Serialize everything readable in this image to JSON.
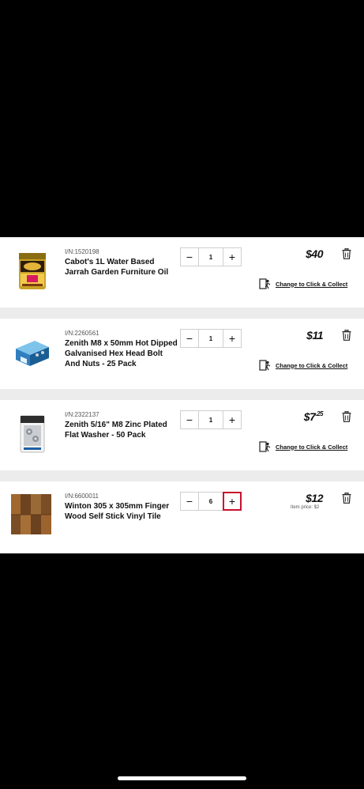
{
  "cart": {
    "items": [
      {
        "item_no": "I/N:1520198",
        "name": "Cabot's 1L Water Based Jarrah Garden Furniture Oil",
        "quantity": "1",
        "price_main": "$40",
        "price_cents": "",
        "unit_price": "",
        "collect_label": "Change to Click & Collect"
      },
      {
        "item_no": "I/N:2260561",
        "name": "Zenith M8 x 50mm Hot Dipped Galvanised Hex Head Bolt And Nuts - 25 Pack",
        "quantity": "1",
        "price_main": "$11",
        "price_cents": "",
        "unit_price": "",
        "collect_label": "Change to Click & Collect"
      },
      {
        "item_no": "I/N:2322137",
        "name": "Zenith 5/16\" M8 Zinc Plated Flat Washer - 50 Pack",
        "quantity": "1",
        "price_main": "$7",
        "price_cents": ".25",
        "unit_price": "",
        "collect_label": "Change to Click & Collect"
      },
      {
        "item_no": "I/N:6600011",
        "name": "Winton 305 x 305mm Finger Wood Self Stick Vinyl Tile",
        "quantity": "6",
        "price_main": "$12",
        "price_cents": "",
        "unit_price": "Item price: $2",
        "collect_label": ""
      }
    ],
    "stepper": {
      "minus": "−",
      "plus": "+"
    }
  },
  "colors": {
    "accent_red": "#c8102e",
    "card_bg": "#ffffff",
    "separator": "#ececec"
  },
  "icons": [
    "trash-icon",
    "click-collect-icon",
    "minus-icon",
    "plus-icon"
  ]
}
